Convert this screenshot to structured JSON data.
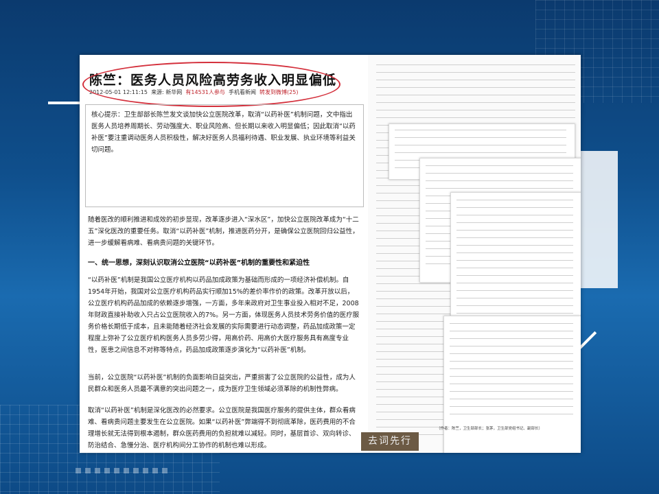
{
  "article": {
    "headline": "陈竺：医务人员风险高劳务收入明显偏低",
    "date": "2012-05-01 12:11:15",
    "source_label": "来源:",
    "source": "新华网",
    "participants": "有14531人参与",
    "mobile": "手机看新闻",
    "share": "转发到微博(25)",
    "summary": "核心提示：卫生部部长陈竺发文谈加快公立医院改革，取消“以药补医”机制问题，文中指出医务人员培养周期长、劳动强度大、职业风险高、但长期以来收入明显偏低；因此取消“以药补医”要注重调动医务人员积极性，解决好医务人员福利待遇、职业发展、执业环境等利益关切问题。",
    "paragraphs": [
      "随着医改的顺利推进和成效的初步显现，改革逐步进入“深水区”，加快公立医院改革成为“十二五”深化医改的重要任务。取消“以药补医”机制，推进医药分开，是确保公立医院回归公益性，进一步缓解看病难、看病贵问题的关键环节。",
      "“以药补医”机制是我国公立医疗机构以药品加成政策为基础而形成的一项经济补偿机制。自1954年开始，我国对公立医疗机构药品实行顺加15%的差价率作价的政策。改革开放以后，公立医疗机构药品加成的依赖逐步增强，一方面，多年来政府对卫生事业投入相对不足，2008年财政直接补助收入只占公立医院收入的7%。另一方面，体现医务人员技术劳务价值的医疗服务价格长期低于成本，且未能随着经济社会发展的实际需要进行动态调整，药品加成政策一定程度上弥补了公立医疗机构医务人员多劳少得，用高价药、用高价大医疗服务具有高度专业性，医患之间信息不对称等特点，药品加成政策逐步演化为“以药补医”机制。",
      "当前，公立医院“以药补医”机制的负面影响日益突出，严重损害了公立医院的公益性，成为人民群众和医务人员最不满意的突出问题之一，成为医疗卫生领域必须革除的机制性弊病。",
      "取消“以药补医”机制是深化医改的必然要求。公立医院是我国医疗服务的提供主体，群众看病难、看病贵问题主要发生在公立医院。如果“以药补医”弊端得不到彻底革除，医药费用的不合理增长就无法得到根本遏制，群众医药费用的负担就难以减轻。同时，基层首诊、双向转诊、防治结合、急慢分治、医疗机构间分工协作的机制也难以形成。"
    ],
    "section_title": "一、统一思想，深刻认识取消公立医院“以药补医”机制的重要性和紧迫性"
  },
  "side": {
    "badge": "去词先行",
    "caption": "（作者：陈竺，卫生部部长；张茅，卫生部党组书记、副部长）"
  }
}
